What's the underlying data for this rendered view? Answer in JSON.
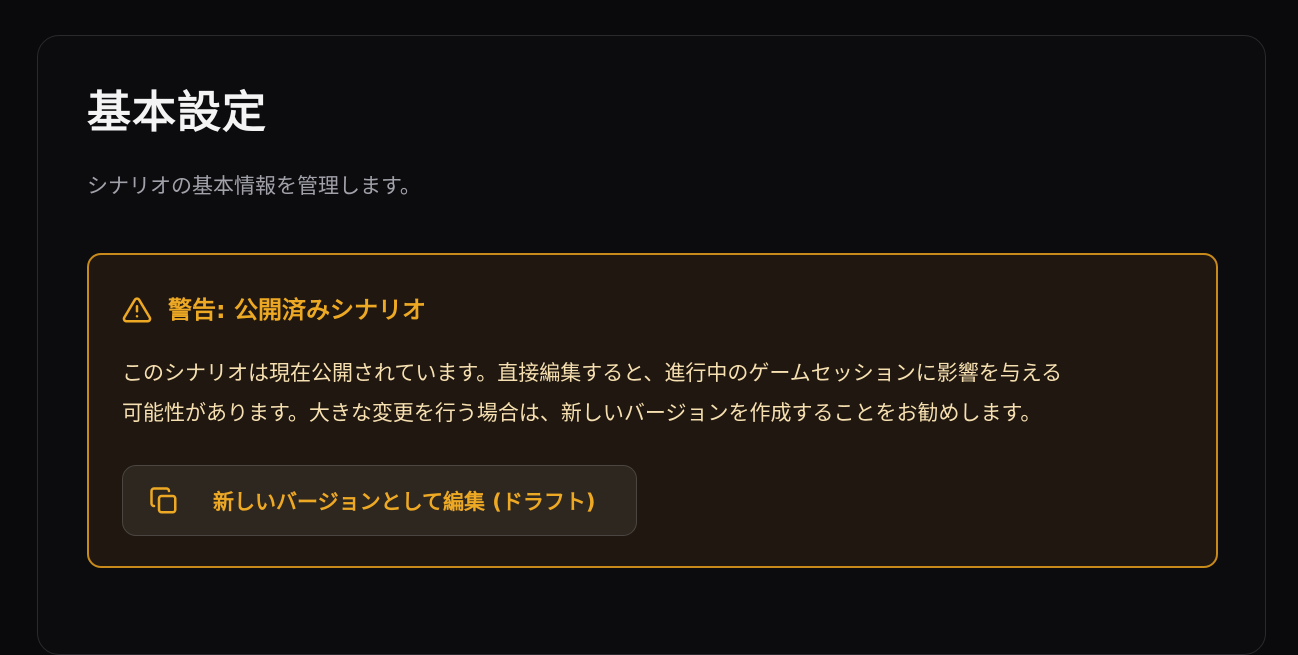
{
  "settings": {
    "title": "基本設定",
    "subtitle": "シナリオの基本情報を管理します。"
  },
  "warning": {
    "icon": "alert-triangle-icon",
    "title": "警告: 公開済みシナリオ",
    "body_line1": "このシナリオは現在公開されています。直接編集すると、進行中のゲームセッションに影響を与える",
    "body_line2": "可能性があります。大きな変更を行う場合は、新しいバージョンを作成することをお勧めします。",
    "accent_color": "#eea924",
    "border_color": "#c98a1c"
  },
  "actions": {
    "draft_button_icon": "copy-icon",
    "draft_button_label": "新しいバージョンとして編集 (ドラフト)"
  }
}
